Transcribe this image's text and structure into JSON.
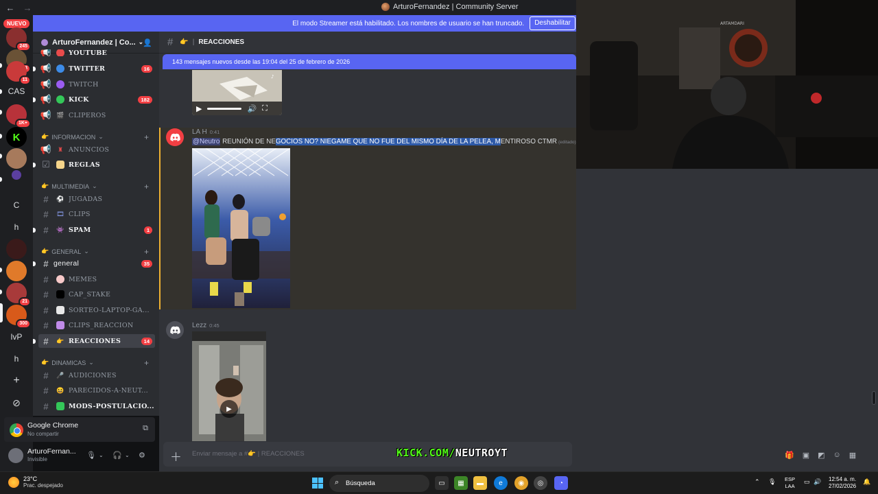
{
  "titlebar": {
    "title": "ArturoFernandez | Community Server"
  },
  "banner": {
    "message": "El modo Streamer está habilitado. Los nombres de usuario se han truncado.",
    "button": "Deshabilitar"
  },
  "rail": {
    "nuevo": "NUEVO",
    "servers": [
      {
        "label": "",
        "badge": "245"
      },
      {
        "label": "",
        "badge": "643"
      },
      {
        "label": "",
        "badge": "11"
      },
      {
        "label": "CAS",
        "badge": ""
      },
      {
        "label": "",
        "badge": "1K+"
      },
      {
        "label": "K",
        "badge": ""
      },
      {
        "label": "",
        "badge": ""
      },
      {
        "label": "",
        "badge": ""
      },
      {
        "label": "C",
        "badge": ""
      },
      {
        "label": "h",
        "badge": ""
      },
      {
        "label": "",
        "badge": ""
      },
      {
        "label": "",
        "badge": ""
      },
      {
        "label": "",
        "badge": "21"
      },
      {
        "label": "",
        "badge": "300"
      },
      {
        "label": "lvP",
        "badge": ""
      },
      {
        "label": "h",
        "badge": ""
      },
      {
        "label": "+",
        "badge": ""
      },
      {
        "label": "⊘",
        "badge": ""
      }
    ]
  },
  "guild": {
    "name": "ArturoFernandez | Co..."
  },
  "channels": {
    "youtube": "YOUTUBE",
    "twitter": "TWITTER",
    "twitter_count": "16",
    "twitch": "TWITCH",
    "kick": "KICK",
    "kick_count": "182",
    "clipers": "CLIPEROS",
    "cat_info": "INFORMACION",
    "anuncios": "ANUNCIOS",
    "reglas": "REGLAS",
    "cat_multimedia": "MULTIMEDIA",
    "jugadas": "JUGADAS",
    "clips": "CLIPS",
    "spam": "SPAM",
    "spam_count": "1",
    "cat_general": "GENERAL",
    "general": "general",
    "general_count": "35",
    "memes": "MEMES",
    "cap_stake": "CAP_STAKE",
    "sorteo": "SORTEO-LAPTOP-GA...",
    "clips_reaccion": "CLIPS_REACCION",
    "reacciones": "REACCIONES",
    "reacciones_count": "14",
    "cat_dinamicas": "DINAMICAS",
    "audiciones": "AUDICIONES",
    "parecidos": "PARECIDOS-A-NEUT...",
    "mods": "MODS-POSTULACIO..."
  },
  "voice": {
    "app": "Google Chrome",
    "status": "No compartir"
  },
  "user": {
    "name": "ArturoFernan...",
    "status": "Invisible"
  },
  "chat": {
    "header": "REACCIONES",
    "new_messages": "143 mensajes nuevos desde las 19:04 del 25 de febrero de 2026",
    "msg1_author": "LA H",
    "msg1_time": "0:41",
    "msg1_mention": "@Neutro",
    "msg1_text_a": " REUNIÓN DE NE",
    "msg1_text_sel": "GOCIOS NO? NIEGAME QUE NO FUE DEL MISMO DÍA DE LA PELEA, M",
    "msg1_text_b": "ENTIROSO CTMR",
    "msg1_edited": "(editado)",
    "msg2_author": "Lezz",
    "msg2_time": "0:45",
    "composer_placeholder": "Enviar mensaje a #👉 | REACCIONES"
  },
  "overlay": {
    "kick_a": "KICK.COM/",
    "kick_b": "NEUTROYT"
  },
  "taskbar": {
    "temp": "23°C",
    "weather": "Prac. despejado",
    "search": "Búsqueda",
    "lang1": "ESP",
    "lang2": "LAA",
    "time": "12:54 a. m.",
    "date": "27/02/2026"
  },
  "colors": {
    "accent": "#5865f2",
    "danger": "#f23f43",
    "kick": "#53fc18"
  }
}
